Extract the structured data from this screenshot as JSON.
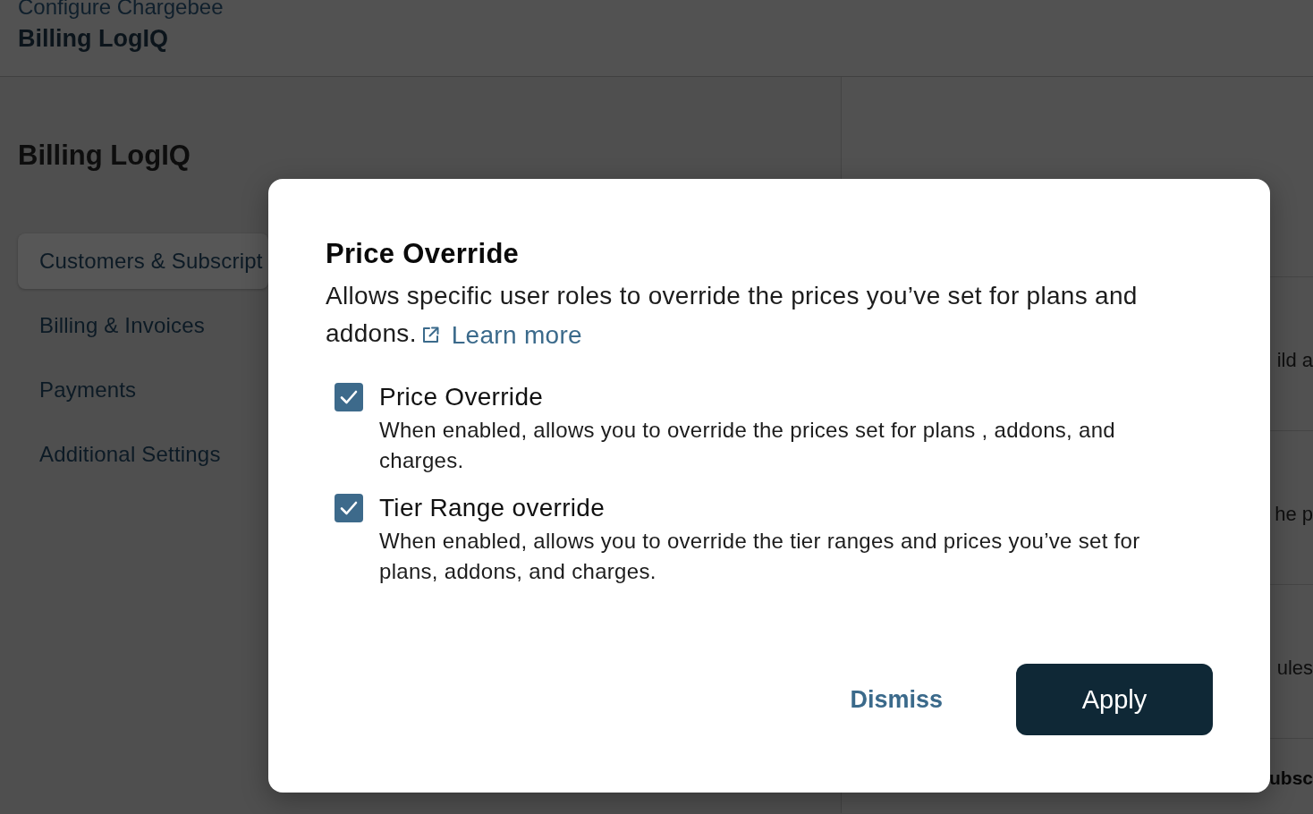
{
  "header": {
    "breadcrumb": "Configure Chargebee",
    "title": "Billing LogIQ"
  },
  "page": {
    "title": "Billing LogIQ"
  },
  "sidebar": {
    "items": [
      {
        "label": "Customers & Subscript",
        "selected": true
      },
      {
        "label": "Billing & Invoices",
        "selected": false
      },
      {
        "label": "Payments",
        "selected": false
      },
      {
        "label": "Additional Settings",
        "selected": false
      }
    ]
  },
  "settings_panel": {
    "rows": [
      {
        "kind": "text",
        "text": "ild a"
      },
      {
        "kind": "text",
        "text": "he p"
      },
      {
        "kind": "text",
        "text": "ules"
      },
      {
        "kind": "heading",
        "text": "ubsc"
      }
    ]
  },
  "dialog": {
    "title": "Price Override",
    "description": "Allows specific user roles to override the prices you’ve set for plans and addons.",
    "link": "Learn more",
    "options": [
      {
        "label": "Price Override",
        "description": "When enabled, allows you to override the prices set for plans , addons, and charges.",
        "checked": true
      },
      {
        "label": "Tier Range override",
        "description": "When enabled, allows you to override the tier ranges and prices you’ve set for plans, addons, and charges.",
        "checked": true
      }
    ],
    "buttons": [
      {
        "kind": "secondary",
        "label": "Dismiss"
      },
      {
        "kind": "primary",
        "label": "Apply"
      }
    ]
  }
}
